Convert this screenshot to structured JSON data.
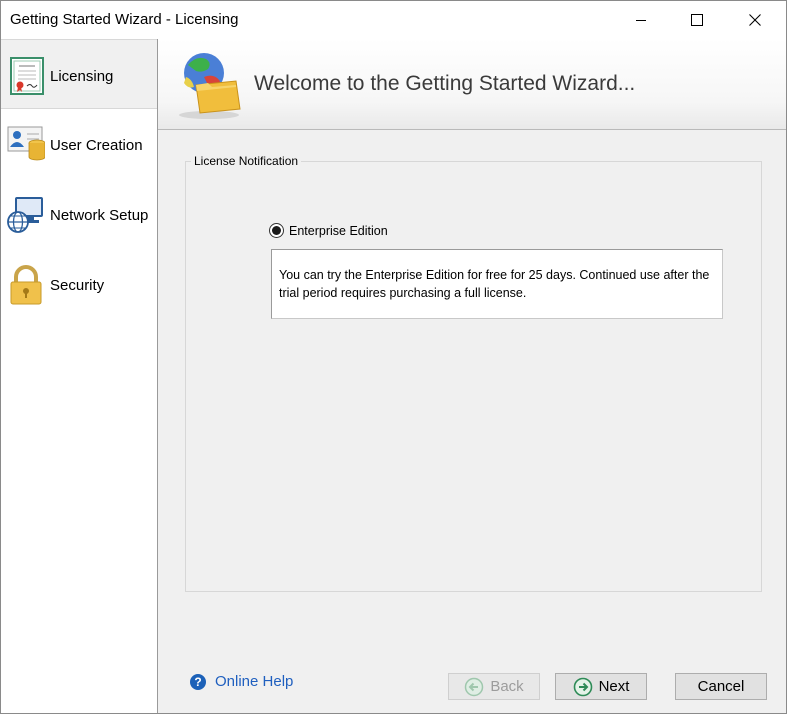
{
  "window": {
    "title": "Getting Started Wizard - Licensing",
    "controls": [
      "minimize-icon",
      "maximize-icon",
      "close-icon"
    ]
  },
  "sidebar": {
    "items": [
      {
        "label": "Licensing",
        "icon": "certificate-icon",
        "selected": true
      },
      {
        "label": "User Creation",
        "icon": "user-database-icon",
        "selected": false
      },
      {
        "label": "Network Setup",
        "icon": "network-computer-icon",
        "selected": false
      },
      {
        "label": "Security",
        "icon": "padlock-icon",
        "selected": false
      }
    ]
  },
  "banner": {
    "title": "Welcome to the Getting Started Wizard...",
    "icon": "globe-folder-icon"
  },
  "license": {
    "group_title": "License Notification",
    "option_label": "Enterprise Edition",
    "option_selected": true,
    "message": "You can try the Enterprise Edition for free for 25 days. Continued use after the trial period requires purchasing a full license."
  },
  "footer": {
    "help_label": "Online Help",
    "back_label": "Back",
    "back_enabled": false,
    "next_label": "Next",
    "cancel_label": "Cancel"
  },
  "colors": {
    "link": "#1f5fbf",
    "sidebar_selected": "#f0f0f0",
    "button_face": "#e1e1e1"
  }
}
